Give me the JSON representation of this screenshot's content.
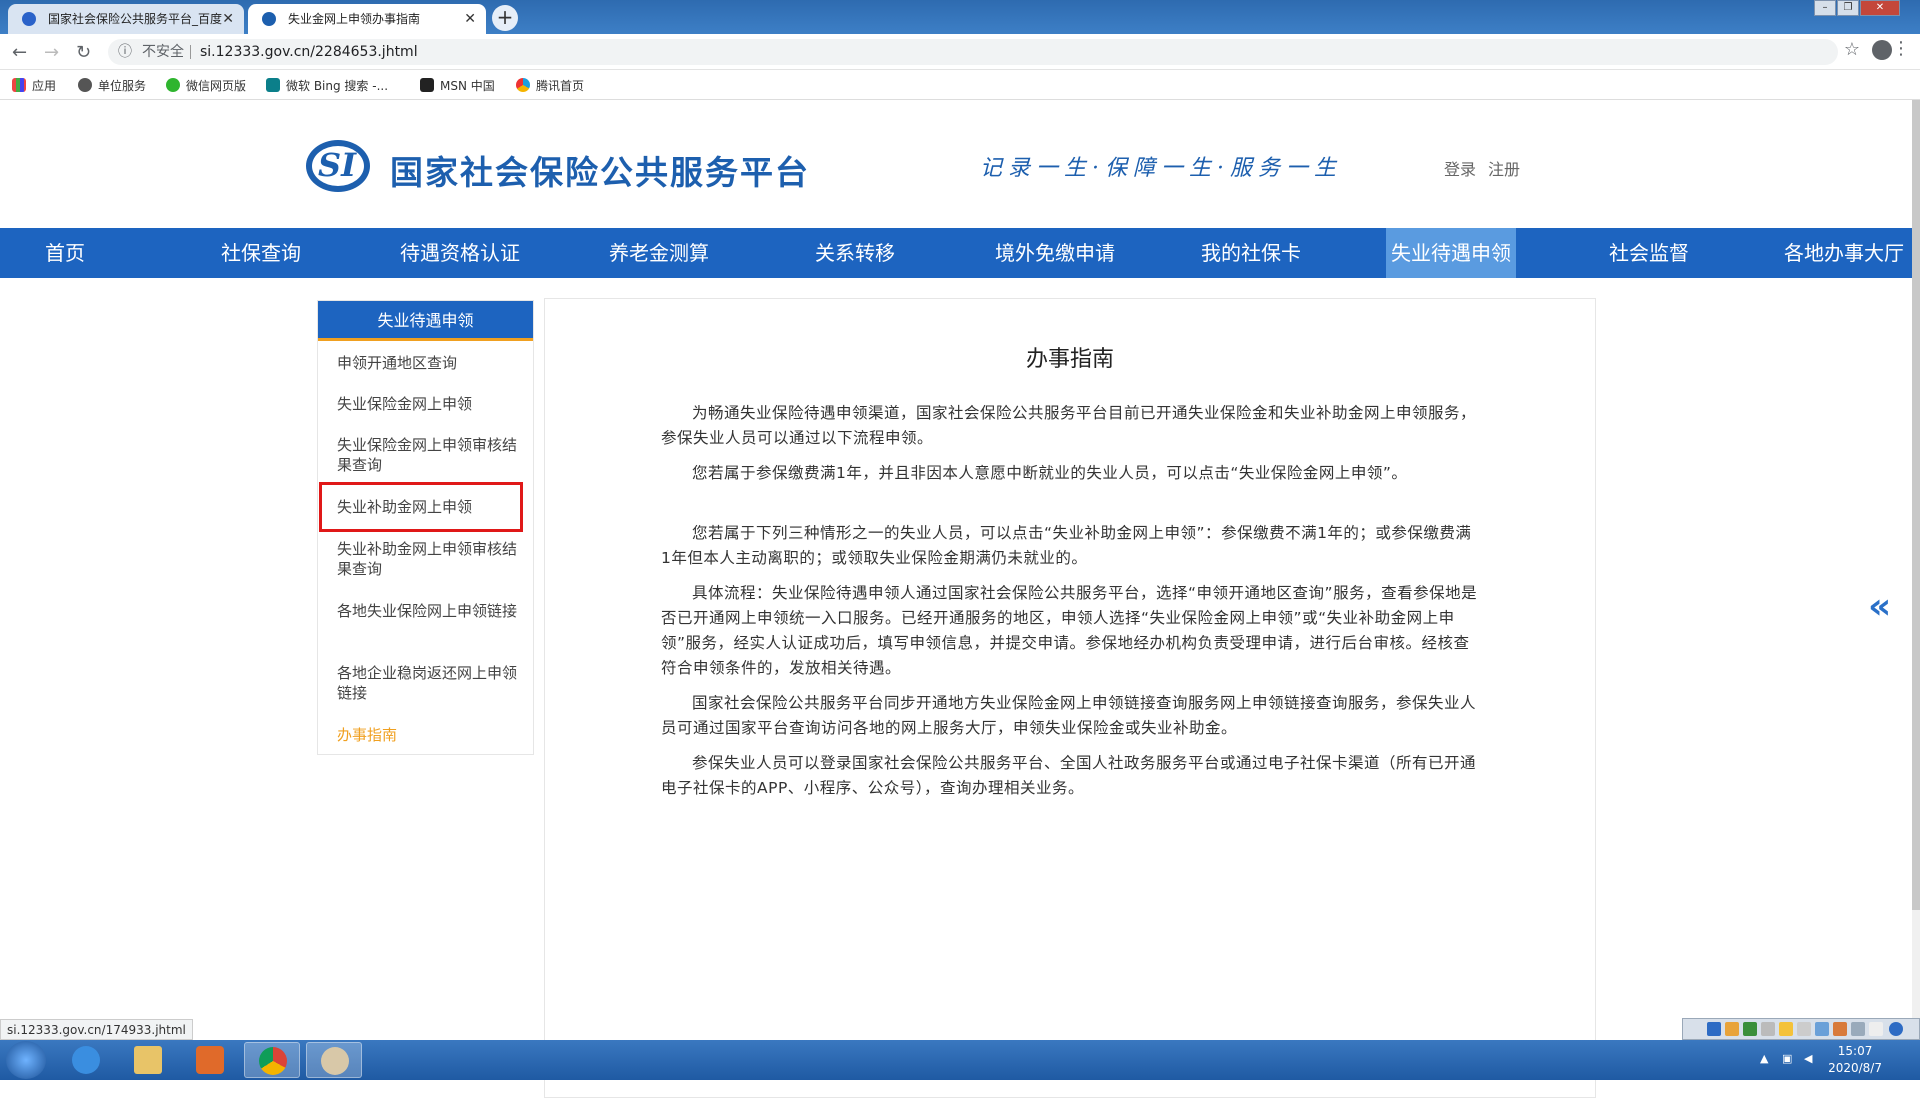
{
  "browser": {
    "tabs": [
      {
        "title": "国家社会保险公共服务平台_百度",
        "active": false
      },
      {
        "title": "失业金网上申领办事指南",
        "active": true
      }
    ],
    "new_tab": "+",
    "address": {
      "security": "不安全",
      "url": "si.12333.gov.cn/2284653.jhtml"
    },
    "bookmarks": [
      {
        "label": "应用",
        "icon": "apps-grid-icon"
      },
      {
        "label": "单位服务",
        "icon": "globe-icon"
      },
      {
        "label": "微信网页版",
        "icon": "wechat-icon"
      },
      {
        "label": "微软 Bing 搜索 -...",
        "icon": "bing-icon"
      },
      {
        "label": "MSN 中国",
        "icon": "msn-icon"
      },
      {
        "label": "腾讯首页",
        "icon": "tencent-icon"
      }
    ],
    "status_url": "si.12333.gov.cn/174933.jhtml"
  },
  "site": {
    "logo_text": "SI",
    "name": "国家社会保险公共服务平台",
    "slogan": "记录一生·保障一生·服务一生",
    "login": "登录",
    "register": "注册"
  },
  "nav": {
    "items": [
      "首页",
      "社保查询",
      "待遇资格认证",
      "养老金测算",
      "关系转移",
      "境外免缴申请",
      "我的社保卡",
      "失业待遇申领",
      "社会监督",
      "各地办事大厅"
    ],
    "active_index": 7
  },
  "sidebar": {
    "title": "失业待遇申领",
    "items": [
      "申领开通地区查询",
      "失业保险金网上申领",
      "失业保险金网上申领审核结果查询",
      "失业补助金网上申领",
      "失业补助金网上申领审核结果查询",
      "各地失业保险网上申领链接",
      "各地企业稳岗返还网上申领链接",
      "办事指南"
    ],
    "current_index": 7,
    "highlighted_index": 3
  },
  "content": {
    "title": "办事指南",
    "paragraphs": [
      "为畅通失业保险待遇申领渠道，国家社会保险公共服务平台目前已开通失业保险金和失业补助金网上申领服务，参保失业人员可以通过以下流程申领。",
      "您若属于参保缴费满1年，并且非因本人意愿中断就业的失业人员，可以点击“失业保险金网上申领”。",
      "您若属于下列三种情形之一的失业人员，可以点击“失业补助金网上申领”：参保缴费不满1年的；或参保缴费满1年但本人主动离职的；或领取失业保险金期满仍未就业的。",
      "具体流程：失业保险待遇申领人通过国家社会保险公共服务平台，选择“申领开通地区查询”服务，查看参保地是否已开通网上申领统一入口服务。已经开通服务的地区，申领人选择“失业保险金网上申领”或“失业补助金网上申领”服务，经实人认证成功后，填写申领信息，并提交申请。参保地经办机构负责受理申请，进行后台审核。经核查符合申领条件的，发放相关待遇。",
      "国家社会保险公共服务平台同步开通地方失业保险金网上申领链接查询服务网上申领链接查询服务，参保失业人员可通过国家平台查询访问各地的网上服务大厅，申领失业保险金或失业补助金。",
      "参保失业人员可以登录国家社会保险公共服务平台、全国人社政务服务平台或通过电子社保卡渠道（所有已开通电子社保卡的APP、小程序、公众号），查询办理相关业务。"
    ]
  },
  "taskbar": {
    "time": "15:07",
    "date": "2020/8/7"
  },
  "colors": {
    "brand_blue": "#1d64c0",
    "nav_active": "#5a9be0",
    "current_item": "#f0a020",
    "highlight_red": "#e01818"
  }
}
